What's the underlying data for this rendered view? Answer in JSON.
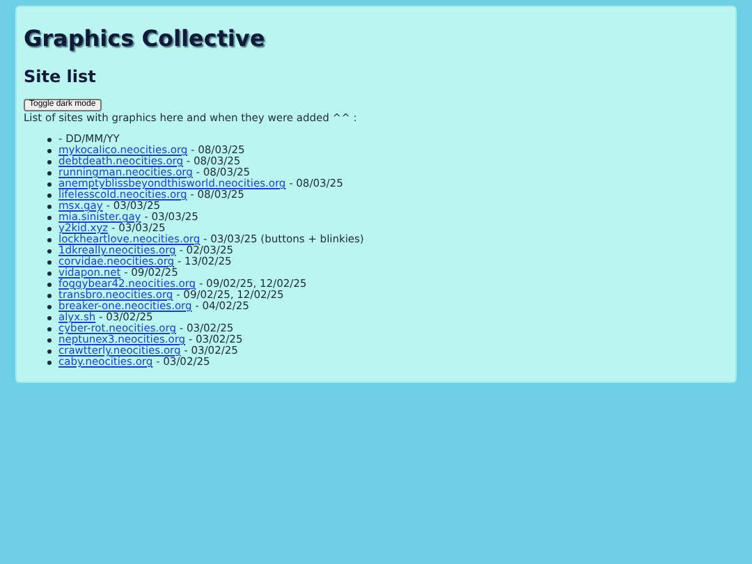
{
  "title": "Graphics Collective",
  "heading": "Site list",
  "toggle_button": "Toggle dark mode",
  "intro": "List of sites with graphics here and when they were added ^^ :",
  "sites": [
    {
      "kind": "plain",
      "text": "- DD/MM/YY"
    },
    {
      "kind": "link",
      "link": "mykocalico.neocities.org",
      "text": " - 08/03/25"
    },
    {
      "kind": "link",
      "link": "debtdeath.neocities.org",
      "text": " - 08/03/25"
    },
    {
      "kind": "link",
      "link": "runningman.neocities.org",
      "text": " - 08/03/25"
    },
    {
      "kind": "link",
      "link": "anemptyblissbeyondthisworld.neocities.org",
      "text": " - 08/03/25"
    },
    {
      "kind": "link",
      "link": "lifelesscold.neocities.org",
      "text": " - 08/03/25"
    },
    {
      "kind": "link",
      "link": "msx.gay",
      "text": " - 03/03/25"
    },
    {
      "kind": "link",
      "link": "mia.sinister.gay",
      "text": " - 03/03/25"
    },
    {
      "kind": "link",
      "link": "y2kid.xyz",
      "text": " - 03/03/25"
    },
    {
      "kind": "link",
      "link": "lockheartlove.neocities.org",
      "text": " - 03/03/25 (buttons + blinkies)"
    },
    {
      "kind": "link",
      "link": "1dkreally.neocities.org",
      "text": " - 02/03/25"
    },
    {
      "kind": "link",
      "link": "corvidae.neocities.org",
      "text": " - 13/02/25"
    },
    {
      "kind": "link",
      "link": "vidapon.net",
      "text": " - 09/02/25"
    },
    {
      "kind": "link",
      "link": "foggybear42.neocities.org",
      "text": " - 09/02/25, 12/02/25"
    },
    {
      "kind": "link",
      "link": "transbro.neocities.org",
      "text": " - 09/02/25, 12/02/25"
    },
    {
      "kind": "link",
      "link": "breaker-one.neocities.org",
      "text": " - 04/02/25"
    },
    {
      "kind": "link",
      "link": "alyx.sh",
      "text": " - 03/02/25"
    },
    {
      "kind": "link",
      "link": "cyber-rot.neocities.org",
      "text": " - 03/02/25"
    },
    {
      "kind": "link",
      "link": "neptunex3.neocities.org",
      "text": " - 03/02/25"
    },
    {
      "kind": "link",
      "link": "crawtterly.neocities.org",
      "text": " - 03/02/25"
    },
    {
      "kind": "link",
      "link": "caby.neocities.org",
      "text": " - 03/02/25"
    }
  ]
}
